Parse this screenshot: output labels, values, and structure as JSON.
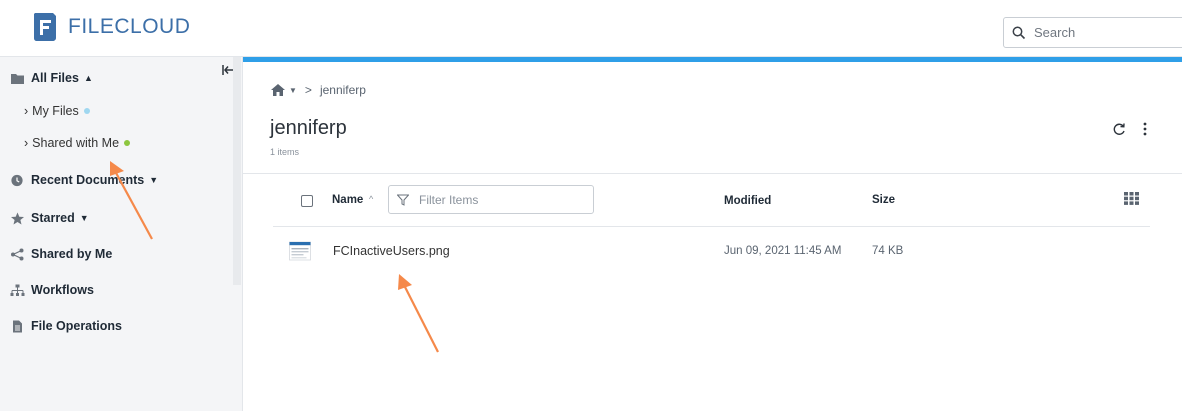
{
  "header": {
    "brand": "FILECLOUD",
    "search_placeholder": "Search",
    "brand_color": "#3c6fa8"
  },
  "sidebar": {
    "all_files": "All Files",
    "my_files": "My Files",
    "shared_with_me": "Shared with Me",
    "recent_documents": "Recent Documents",
    "starred": "Starred",
    "shared_by_me": "Shared by Me",
    "workflows": "Workflows",
    "file_operations": "File Operations",
    "dot_colors": {
      "my_files": "#9fd7f0",
      "shared_with_me": "#8dc63f"
    }
  },
  "breadcrumb": {
    "current": "jenniferp",
    "separator": ">"
  },
  "folder": {
    "title": "jenniferp",
    "count": "1 items"
  },
  "table": {
    "col_name": "Name",
    "filter_placeholder": "Filter Items",
    "col_modified": "Modified",
    "col_size": "Size",
    "rows": [
      {
        "name": "FCInactiveUsers.png",
        "modified": "Jun 09, 2021 11:45 AM",
        "size": "74 KB"
      }
    ]
  },
  "colors": {
    "accent_bar": "#2f9fe8",
    "annotation_arrow": "#f5894a"
  }
}
